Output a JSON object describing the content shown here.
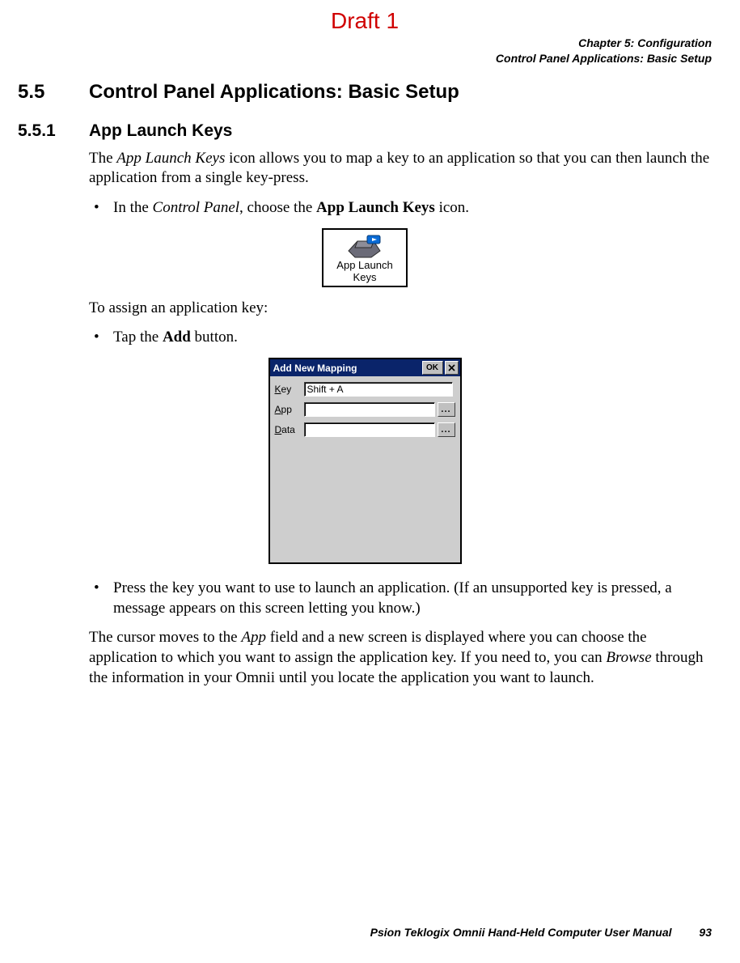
{
  "watermark": "Draft 1",
  "header": {
    "chapter_line": "Chapter 5: Configuration",
    "section_line": "Control Panel Applications: Basic Setup"
  },
  "h1": {
    "num": "5.5",
    "title": "Control Panel Applications: Basic Setup"
  },
  "h2": {
    "num": "5.5.1",
    "title": "App Launch Keys"
  },
  "intro_prefix": "The ",
  "intro_em": "App Launch Keys",
  "intro_suffix": " icon allows you to map a key to an application so that you can then launch the application from a single key-press.",
  "bullet1_prefix": "In the ",
  "bullet1_em": "Control Panel",
  "bullet1_mid": ", choose the ",
  "bullet1_bold": "App Launch Keys",
  "bullet1_suffix": " icon.",
  "icon_figure": {
    "label_line1": "App Launch",
    "label_line2": "Keys"
  },
  "assign_line": "To assign an application key:",
  "bullet2_prefix": "Tap the ",
  "bullet2_bold": "Add",
  "bullet2_suffix": " button.",
  "dialog": {
    "title": "Add New Mapping",
    "ok": "OK",
    "rows": {
      "key": {
        "label_accel": "K",
        "label_rest": "ey",
        "value": "Shift + A"
      },
      "app": {
        "label_accel": "A",
        "label_rest": "pp",
        "value": "",
        "browse": "..."
      },
      "data": {
        "label_accel": "D",
        "label_rest": "ata",
        "value": "",
        "browse": "..."
      }
    }
  },
  "bullet3": "Press the key you want to use to launch an application. (If an unsupported key is pressed, a message appears on this screen letting you know.)",
  "para2_prefix": "The cursor moves to the ",
  "para2_em1": "App",
  "para2_mid": " field and a new screen is displayed where you can choose the application to which you want to assign the application key. If you need to, you can ",
  "para2_em2": "Browse",
  "para2_suffix": " through the information in your Omnii until you locate the application you want to launch.",
  "footer": {
    "text": "Psion Teklogix Omnii Hand-Held Computer User Manual",
    "page": "93"
  }
}
